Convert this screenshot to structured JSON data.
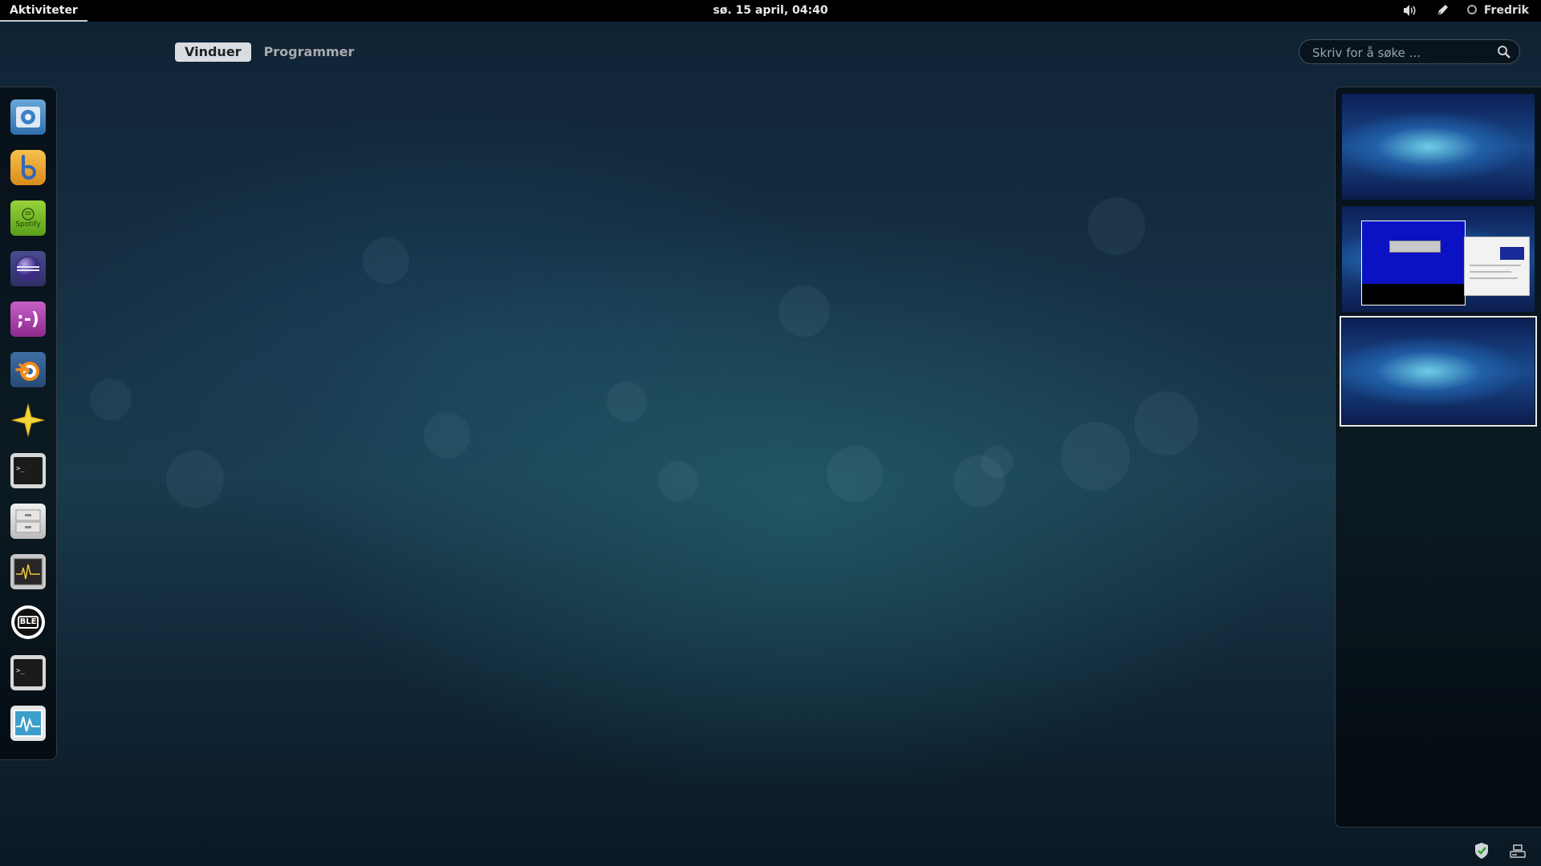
{
  "top_panel": {
    "activities_label": "Aktiviteter",
    "clock": "sø. 15 april, 04:40",
    "user_name": "Fredrik"
  },
  "view_selector": {
    "tabs": [
      {
        "label": "Vinduer",
        "active": true
      },
      {
        "label": "Programmer",
        "active": false
      }
    ]
  },
  "search": {
    "placeholder": "Skriv for å søke ..."
  },
  "dash": {
    "apps": [
      {
        "icon": "chromium-icon"
      },
      {
        "icon": "banshee-icon"
      },
      {
        "icon": "spotify-icon",
        "text": "Spotify"
      },
      {
        "icon": "eclipse-icon"
      },
      {
        "icon": "empathy-icon",
        "text": ";-)"
      },
      {
        "icon": "blender-icon"
      },
      {
        "icon": "inkscape-star-icon"
      },
      {
        "icon": "terminal-icon",
        "text": ">_"
      },
      {
        "icon": "file-cabinet-icon"
      },
      {
        "icon": "system-monitor-icon"
      },
      {
        "icon": "uble-icon",
        "text": "BLE"
      },
      {
        "icon": "terminal-icon",
        "text": ">_"
      },
      {
        "icon": "waveform-monitor-icon"
      }
    ]
  },
  "workspaces": [
    {
      "active": false,
      "has_windows": false
    },
    {
      "active": false,
      "has_windows": true
    },
    {
      "active": true,
      "has_windows": false
    }
  ],
  "colors": {
    "panel_bg": "#000000",
    "active_tab_bg": "#d9dde1",
    "desktop_teal": "#1a3b4d"
  }
}
